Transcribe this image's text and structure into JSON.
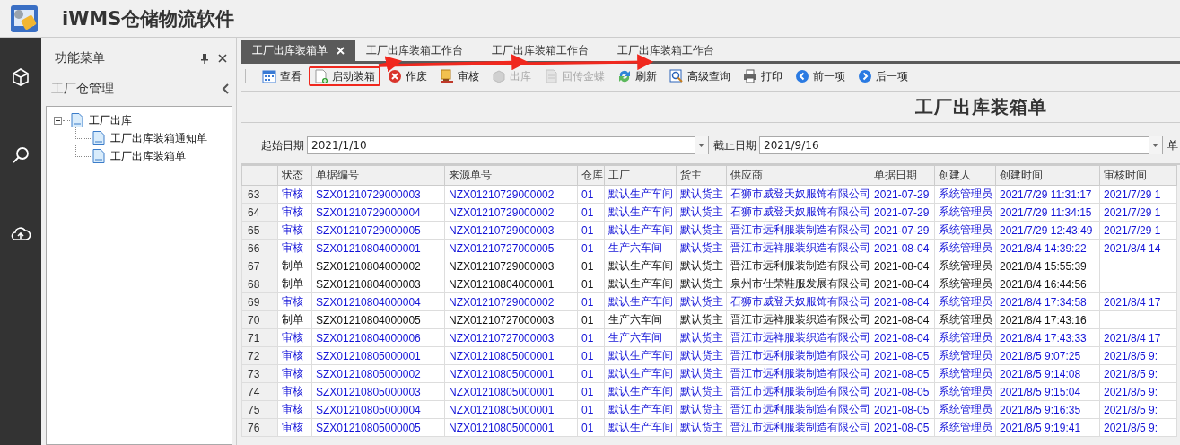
{
  "app": {
    "title": "iWMS仓储物流软件"
  },
  "sidebar": {
    "title": "功能菜单",
    "section": "工厂仓管理",
    "tree": [
      {
        "label": "工厂出库",
        "expanded": true,
        "children": [
          {
            "label": "工厂出库装箱通知单"
          },
          {
            "label": "工厂出库装箱单"
          }
        ]
      }
    ]
  },
  "tabs": [
    {
      "label": "工厂出库装箱单",
      "selected": true,
      "arrow_target": false
    },
    {
      "label": "工厂出库装箱工作台",
      "selected": false,
      "arrow_target": true
    },
    {
      "label": "工厂出库装箱工作台",
      "selected": false,
      "arrow_target": true
    },
    {
      "label": "工厂出库装箱工作台",
      "selected": false,
      "arrow_target": true
    }
  ],
  "toolbar": [
    {
      "label": "查看",
      "disabled": false,
      "highlighted": false
    },
    {
      "label": "启动装箱",
      "disabled": false,
      "highlighted": true
    },
    {
      "label": "作废",
      "disabled": false,
      "highlighted": false
    },
    {
      "label": "审核",
      "disabled": false,
      "highlighted": false
    },
    {
      "label": "出库",
      "disabled": true,
      "highlighted": false
    },
    {
      "label": "回传金蝶",
      "disabled": true,
      "highlighted": false
    },
    {
      "label": "刷新",
      "disabled": false,
      "highlighted": false
    },
    {
      "label": "高级查询",
      "disabled": false,
      "highlighted": false
    },
    {
      "label": "打印",
      "disabled": false,
      "highlighted": false
    },
    {
      "label": "前一项",
      "disabled": false,
      "highlighted": false
    },
    {
      "label": "后一项",
      "disabled": false,
      "highlighted": false
    }
  ],
  "report_title": "工厂出库装箱单",
  "filters": [
    {
      "label": "起始日期",
      "value": "2021/1/10"
    },
    {
      "label": "截止日期",
      "value": "2021/9/16"
    },
    {
      "label": "单"
    }
  ],
  "table": {
    "columns": [
      "状态",
      "单据编号",
      "来源单号",
      "仓库",
      "工厂",
      "货主",
      "供应商",
      "单据日期",
      "创建人",
      "创建时间",
      "审核时间"
    ],
    "rows": [
      {
        "number": "63",
        "approved": true,
        "cells": [
          "审核",
          "SZX01210729000003",
          "NZX01210729000002",
          "01",
          "默认生产车间",
          "默认货主",
          "石狮市威登天奴服饰有限公司",
          "2021-07-29",
          "系统管理员",
          "2021/7/29 11:31:17",
          "2021/7/29 1"
        ]
      },
      {
        "number": "64",
        "approved": true,
        "cells": [
          "审核",
          "SZX01210729000004",
          "NZX01210729000002",
          "01",
          "默认生产车间",
          "默认货主",
          "石狮市威登天奴服饰有限公司",
          "2021-07-29",
          "系统管理员",
          "2021/7/29 11:34:15",
          "2021/7/29 1"
        ]
      },
      {
        "number": "65",
        "approved": true,
        "cells": [
          "审核",
          "SZX01210729000005",
          "NZX01210729000003",
          "01",
          "默认生产车间",
          "默认货主",
          "晋江市远利服装制造有限公司",
          "2021-07-29",
          "系统管理员",
          "2021/7/29 12:43:49",
          "2021/7/29 1"
        ]
      },
      {
        "number": "66",
        "approved": true,
        "cells": [
          "审核",
          "SZX01210804000001",
          "NZX01210727000005",
          "01",
          "生产六车间",
          "默认货主",
          "晋江市远祥服装织造有限公司",
          "2021-08-04",
          "系统管理员",
          "2021/8/4 14:39:22",
          "2021/8/4 14"
        ]
      },
      {
        "number": "67",
        "approved": false,
        "cells": [
          "制单",
          "SZX01210804000002",
          "NZX01210729000003",
          "01",
          "默认生产车间",
          "默认货主",
          "晋江市远利服装制造有限公司",
          "2021-08-04",
          "系统管理员",
          "2021/8/4 15:55:39"
        ]
      },
      {
        "number": "68",
        "approved": false,
        "cells": [
          "制单",
          "SZX01210804000003",
          "NZX01210804000001",
          "01",
          "默认生产车间",
          "默认货主",
          "泉州市仕荣鞋服发展有限公司",
          "2021-08-04",
          "系统管理员",
          "2021/8/4 16:44:56"
        ]
      },
      {
        "number": "69",
        "approved": true,
        "cells": [
          "审核",
          "SZX01210804000004",
          "NZX01210729000002",
          "01",
          "默认生产车间",
          "默认货主",
          "石狮市威登天奴服饰有限公司",
          "2021-08-04",
          "系统管理员",
          "2021/8/4 17:34:58",
          "2021/8/4 17"
        ]
      },
      {
        "number": "70",
        "approved": false,
        "cells": [
          "制单",
          "SZX01210804000005",
          "NZX01210727000003",
          "01",
          "生产六车间",
          "默认货主",
          "晋江市远祥服装织造有限公司",
          "2021-08-04",
          "系统管理员",
          "2021/8/4 17:43:16"
        ]
      },
      {
        "number": "71",
        "approved": true,
        "cells": [
          "审核",
          "SZX01210804000006",
          "NZX01210727000003",
          "01",
          "生产六车间",
          "默认货主",
          "晋江市远祥服装织造有限公司",
          "2021-08-04",
          "系统管理员",
          "2021/8/4 17:43:33",
          "2021/8/4 17"
        ]
      },
      {
        "number": "72",
        "approved": true,
        "cells": [
          "审核",
          "SZX01210805000001",
          "NZX01210805000001",
          "01",
          "默认生产车间",
          "默认货主",
          "晋江市远利服装制造有限公司",
          "2021-08-05",
          "系统管理员",
          "2021/8/5 9:07:25",
          "2021/8/5 9:"
        ]
      },
      {
        "number": "73",
        "approved": true,
        "cells": [
          "审核",
          "SZX01210805000002",
          "NZX01210805000001",
          "01",
          "默认生产车间",
          "默认货主",
          "晋江市远利服装制造有限公司",
          "2021-08-05",
          "系统管理员",
          "2021/8/5 9:14:08",
          "2021/8/5 9:"
        ]
      },
      {
        "number": "74",
        "approved": true,
        "cells": [
          "审核",
          "SZX01210805000003",
          "NZX01210805000001",
          "01",
          "默认生产车间",
          "默认货主",
          "晋江市远利服装制造有限公司",
          "2021-08-05",
          "系统管理员",
          "2021/8/5 9:15:04",
          "2021/8/5 9:"
        ]
      },
      {
        "number": "75",
        "approved": true,
        "cells": [
          "审核",
          "SZX01210805000004",
          "NZX01210805000001",
          "01",
          "默认生产车间",
          "默认货主",
          "晋江市远利服装制造有限公司",
          "2021-08-05",
          "系统管理员",
          "2021/8/5 9:16:35",
          "2021/8/5 9:"
        ]
      },
      {
        "number": "76",
        "approved": true,
        "cells": [
          "审核",
          "SZX01210805000005",
          "NZX01210805000001",
          "01",
          "默认生产车间",
          "默认货主",
          "晋江市远利服装制造有限公司",
          "2021-08-05",
          "系统管理员",
          "2021/8/5 9:19:41",
          "2021/8/5 9:"
        ]
      }
    ]
  }
}
